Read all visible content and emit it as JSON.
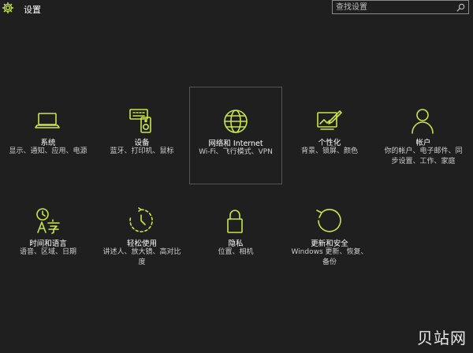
{
  "window": {
    "title": "设置"
  },
  "search": {
    "placeholder": "查找设置"
  },
  "colors": {
    "accent": "#c8e64a",
    "background": "#1f1f1f"
  },
  "tiles": [
    {
      "icon": "laptop-icon",
      "label": "系统",
      "desc": "显示、通知、应用、电源"
    },
    {
      "icon": "devices-icon",
      "label": "设备",
      "desc": "蓝牙、打印机、鼠标"
    },
    {
      "icon": "globe-icon",
      "label": "网络和 Internet",
      "desc": "Wi-Fi、飞行模式、VPN"
    },
    {
      "icon": "personalization-icon",
      "label": "个性化",
      "desc": "背景、锁屏、颜色"
    },
    {
      "icon": "person-icon",
      "label": "帐户",
      "desc": "你的帐户、电子邮件、同步设置、工作、家庭"
    },
    {
      "icon": "time-language-icon",
      "label": "时间和语言",
      "desc": "语音、区域、日期"
    },
    {
      "icon": "ease-of-access-icon",
      "label": "轻松使用",
      "desc": "讲述人、放大镜、高对比度"
    },
    {
      "icon": "lock-icon",
      "label": "隐私",
      "desc": "位置、相机"
    },
    {
      "icon": "update-icon",
      "label": "更新和安全",
      "desc": "Windows 更新、恢复、备份"
    }
  ],
  "watermark": "贝站网"
}
